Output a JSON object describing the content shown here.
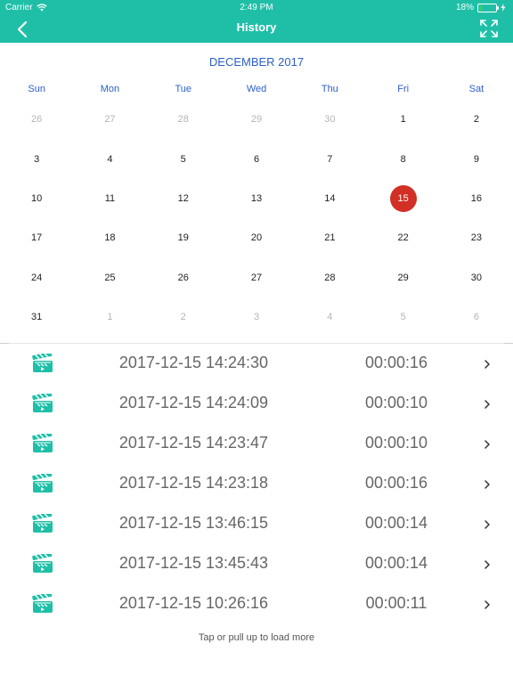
{
  "status_bar": {
    "carrier": "Carrier",
    "time": "2:49 PM",
    "battery": "18%",
    "battery_level": 0.18
  },
  "nav": {
    "title": "History"
  },
  "calendar": {
    "month_title": "DECEMBER 2017",
    "weekdays": [
      "Sun",
      "Mon",
      "Tue",
      "Wed",
      "Thu",
      "Fri",
      "Sat"
    ],
    "selected_day": "15",
    "days": [
      {
        "label": "26",
        "muted": true
      },
      {
        "label": "27",
        "muted": true
      },
      {
        "label": "28",
        "muted": true
      },
      {
        "label": "29",
        "muted": true
      },
      {
        "label": "30",
        "muted": true
      },
      {
        "label": "1",
        "muted": false
      },
      {
        "label": "2",
        "muted": false
      },
      {
        "label": "3",
        "muted": false
      },
      {
        "label": "4",
        "muted": false
      },
      {
        "label": "5",
        "muted": false
      },
      {
        "label": "6",
        "muted": false
      },
      {
        "label": "7",
        "muted": false
      },
      {
        "label": "8",
        "muted": false
      },
      {
        "label": "9",
        "muted": false
      },
      {
        "label": "10",
        "muted": false
      },
      {
        "label": "11",
        "muted": false
      },
      {
        "label": "12",
        "muted": false
      },
      {
        "label": "13",
        "muted": false
      },
      {
        "label": "14",
        "muted": false
      },
      {
        "label": "15",
        "muted": false
      },
      {
        "label": "16",
        "muted": false
      },
      {
        "label": "17",
        "muted": false
      },
      {
        "label": "18",
        "muted": false
      },
      {
        "label": "19",
        "muted": false
      },
      {
        "label": "20",
        "muted": false
      },
      {
        "label": "21",
        "muted": false
      },
      {
        "label": "22",
        "muted": false
      },
      {
        "label": "23",
        "muted": false
      },
      {
        "label": "24",
        "muted": false
      },
      {
        "label": "25",
        "muted": false
      },
      {
        "label": "26",
        "muted": false
      },
      {
        "label": "27",
        "muted": false
      },
      {
        "label": "28",
        "muted": false
      },
      {
        "label": "29",
        "muted": false
      },
      {
        "label": "30",
        "muted": false
      },
      {
        "label": "31",
        "muted": false
      },
      {
        "label": "1",
        "muted": true
      },
      {
        "label": "2",
        "muted": true
      },
      {
        "label": "3",
        "muted": true
      },
      {
        "label": "4",
        "muted": true
      },
      {
        "label": "5",
        "muted": true
      },
      {
        "label": "6",
        "muted": true
      }
    ]
  },
  "recordings": [
    {
      "datetime": "2017-12-15 14:24:30",
      "duration": "00:00:16"
    },
    {
      "datetime": "2017-12-15 14:24:09",
      "duration": "00:00:10"
    },
    {
      "datetime": "2017-12-15 14:23:47",
      "duration": "00:00:10"
    },
    {
      "datetime": "2017-12-15 14:23:18",
      "duration": "00:00:16"
    },
    {
      "datetime": "2017-12-15 13:46:15",
      "duration": "00:00:14"
    },
    {
      "datetime": "2017-12-15 13:45:43",
      "duration": "00:00:14"
    },
    {
      "datetime": "2017-12-15 10:26:16",
      "duration": "00:00:11"
    }
  ],
  "load_more": "Tap or pull up to load more",
  "icons": {
    "back": "chevron-left-icon",
    "expand": "expand-arrows-icon",
    "recording": "clapperboard-icon",
    "row_arrow": "chevron-right-icon",
    "wifi": "wifi-icon",
    "battery": "battery-icon",
    "charging": "charging-bolt-icon"
  },
  "colors": {
    "accent": "#1fbfa7",
    "calendar_text": "#2c5fc9",
    "selected": "#d22f26",
    "icon": "#1fbfa7"
  }
}
